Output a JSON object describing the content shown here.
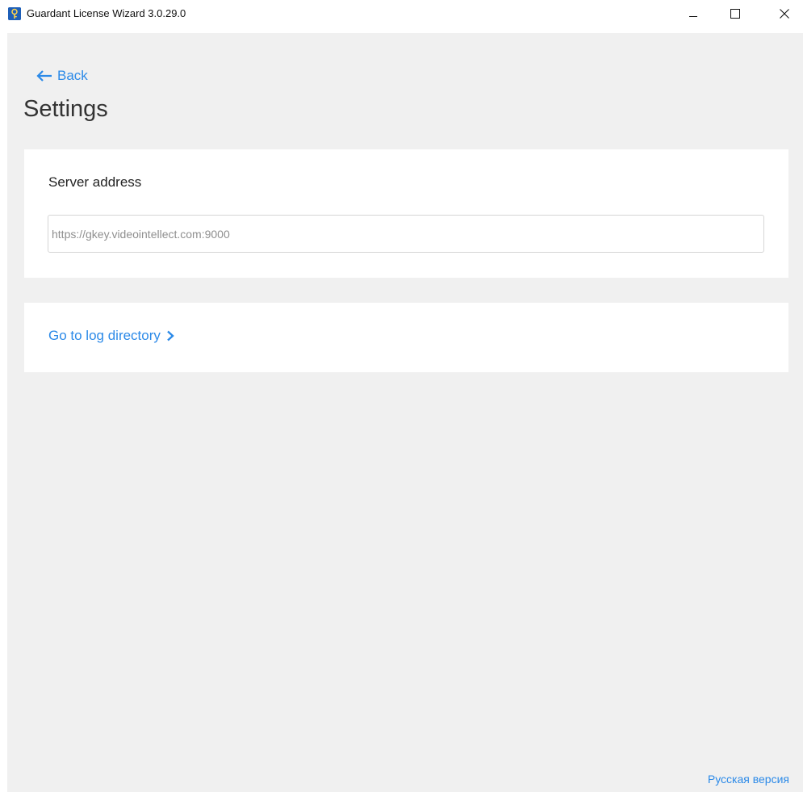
{
  "window": {
    "title": "Guardant License Wizard 3.0.29.0",
    "controls": {
      "minimize_icon": "minimize-icon",
      "maximize_icon": "maximize-icon",
      "close_icon": "close-icon"
    }
  },
  "page": {
    "back_label": "Back",
    "title": "Settings"
  },
  "server": {
    "label": "Server address",
    "value": "",
    "placeholder": "https://gkey.videointellect.com:9000"
  },
  "log": {
    "link_label": "Go to log directory"
  },
  "footer": {
    "language_link": "Русская версия"
  },
  "colors": {
    "accent": "#2c8ae8",
    "background": "#f0f0f0",
    "card": "#ffffff",
    "app_icon": "#1e5fb8"
  }
}
